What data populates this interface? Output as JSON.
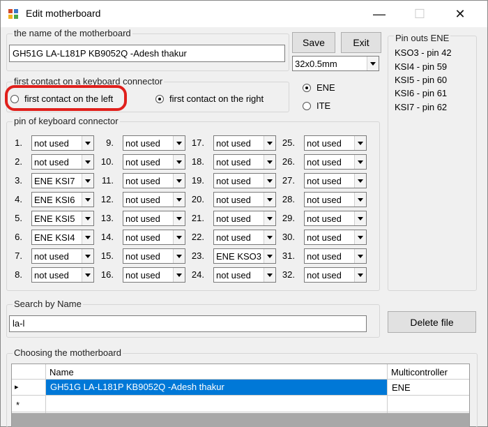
{
  "window": {
    "title": "Edit motherboard"
  },
  "name_group": {
    "title": "the name of the motherboard",
    "value": "GH51G LA-L181P KB9052Q -Adesh thakur"
  },
  "buttons": {
    "save": "Save",
    "exit": "Exit",
    "delete": "Delete file"
  },
  "size_combo": {
    "value": "32x0.5mm"
  },
  "first_contact": {
    "title": "first contact on a keyboard connector",
    "left_label": "first contact on the left",
    "right_label": "first contact on the right",
    "selected": "right"
  },
  "controller": {
    "ene_label": "ENE",
    "ite_label": "ITE",
    "selected": "ENE"
  },
  "pinouts": {
    "title": "Pin outs ENE",
    "lines": [
      "KSO3 - pin 42",
      "KSI4   - pin 59",
      "KSI5   - pin 60",
      "KSI6   - pin 61",
      "KSI7   - pin 62"
    ]
  },
  "pins": {
    "title": "pin of keyboard connector",
    "items": [
      {
        "num": "1.",
        "value": "not used"
      },
      {
        "num": "2.",
        "value": "not used"
      },
      {
        "num": "3.",
        "value": "ENE KSI7"
      },
      {
        "num": "4.",
        "value": "ENE KSI6"
      },
      {
        "num": "5.",
        "value": "ENE KSI5"
      },
      {
        "num": "6.",
        "value": "ENE KSI4"
      },
      {
        "num": "7.",
        "value": "not used"
      },
      {
        "num": "8.",
        "value": "not used"
      },
      {
        "num": "9.",
        "value": "not used"
      },
      {
        "num": "10.",
        "value": "not used"
      },
      {
        "num": "11.",
        "value": "not used"
      },
      {
        "num": "12.",
        "value": "not used"
      },
      {
        "num": "13.",
        "value": "not used"
      },
      {
        "num": "14.",
        "value": "not used"
      },
      {
        "num": "15.",
        "value": "not used"
      },
      {
        "num": "16.",
        "value": "not used"
      },
      {
        "num": "17.",
        "value": "not used"
      },
      {
        "num": "18.",
        "value": "not used"
      },
      {
        "num": "19.",
        "value": "not used"
      },
      {
        "num": "20.",
        "value": "not used"
      },
      {
        "num": "21.",
        "value": "not used"
      },
      {
        "num": "22.",
        "value": "not used"
      },
      {
        "num": "23.",
        "value": "ENE KSO3"
      },
      {
        "num": "24.",
        "value": "not used"
      },
      {
        "num": "25.",
        "value": "not used"
      },
      {
        "num": "26.",
        "value": "not used"
      },
      {
        "num": "27.",
        "value": "not used"
      },
      {
        "num": "28.",
        "value": "not used"
      },
      {
        "num": "29.",
        "value": "not used"
      },
      {
        "num": "30.",
        "value": "not used"
      },
      {
        "num": "31.",
        "value": "not used"
      },
      {
        "num": "32.",
        "value": "not used"
      }
    ]
  },
  "search": {
    "title": "Search by Name",
    "value": "la-l"
  },
  "choosing": {
    "title": "Choosing the motherboard",
    "columns": [
      "Name",
      "Multicontroller"
    ],
    "rows": [
      {
        "marker": "▸",
        "name": "GH51G LA-L181P KB9052Q -Adesh thakur",
        "controller": "ENE"
      },
      {
        "marker": "*",
        "name": "",
        "controller": ""
      }
    ]
  },
  "colors": {
    "selection": "#0078d7",
    "highlight": "#e0201c"
  }
}
